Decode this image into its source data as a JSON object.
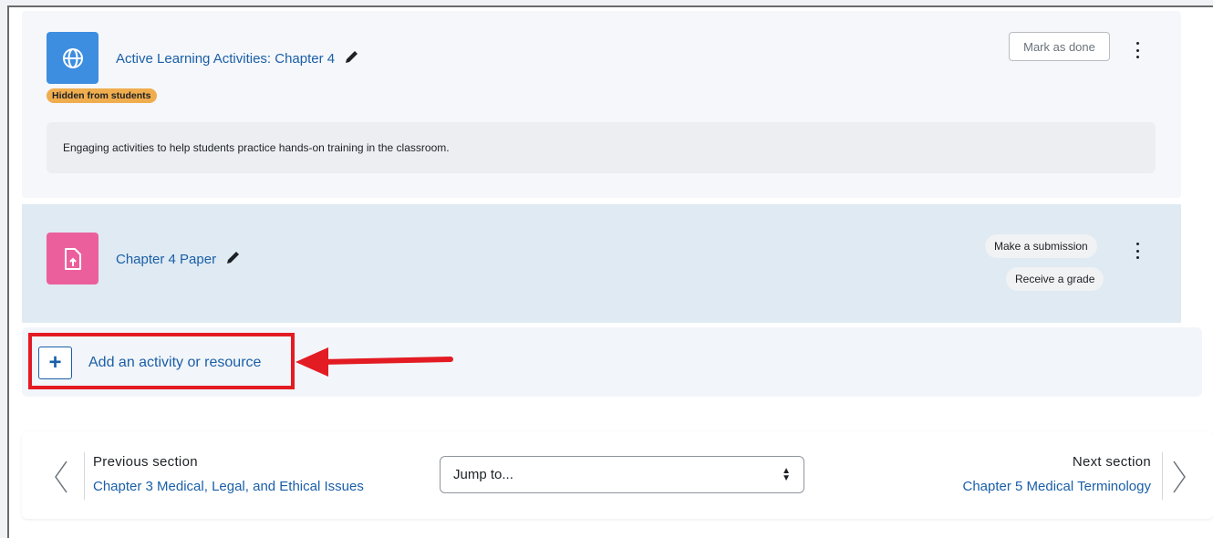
{
  "activities": [
    {
      "title": "Active Learning Activities: Chapter 4",
      "icon": "globe-icon",
      "badge": "Hidden from students",
      "description": "Engaging activities to help students practice hands-on training in the classroom.",
      "button": "Mark as done"
    },
    {
      "title": "Chapter 4 Paper",
      "icon": "assignment-upload-icon",
      "requirements": [
        "Make a submission",
        "Receive a grade"
      ]
    }
  ],
  "add_activity": {
    "label": "Add an activity or resource"
  },
  "navigation": {
    "previous_label": "Previous section",
    "previous_link": "Chapter 3 Medical, Legal, and Ethical Issues",
    "jump_placeholder": "Jump to...",
    "next_label": "Next section",
    "next_link": "Chapter 5 Medical Terminology"
  },
  "colors": {
    "link": "#1a5fa8",
    "badge": "#f0ad4e",
    "highlight": "#e31b23",
    "url_icon_bg": "#3d8ee0",
    "assign_icon_bg": "#ec5f9d"
  }
}
